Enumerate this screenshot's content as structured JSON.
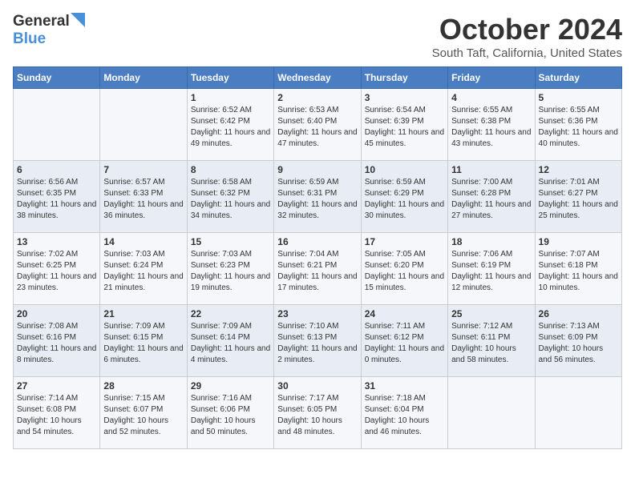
{
  "header": {
    "logo_general": "General",
    "logo_blue": "Blue",
    "month": "October 2024",
    "location": "South Taft, California, United States"
  },
  "weekdays": [
    "Sunday",
    "Monday",
    "Tuesday",
    "Wednesday",
    "Thursday",
    "Friday",
    "Saturday"
  ],
  "weeks": [
    [
      {
        "day": "",
        "info": ""
      },
      {
        "day": "",
        "info": ""
      },
      {
        "day": "1",
        "info": "Sunrise: 6:52 AM\nSunset: 6:42 PM\nDaylight: 11 hours and 49 minutes."
      },
      {
        "day": "2",
        "info": "Sunrise: 6:53 AM\nSunset: 6:40 PM\nDaylight: 11 hours and 47 minutes."
      },
      {
        "day": "3",
        "info": "Sunrise: 6:54 AM\nSunset: 6:39 PM\nDaylight: 11 hours and 45 minutes."
      },
      {
        "day": "4",
        "info": "Sunrise: 6:55 AM\nSunset: 6:38 PM\nDaylight: 11 hours and 43 minutes."
      },
      {
        "day": "5",
        "info": "Sunrise: 6:55 AM\nSunset: 6:36 PM\nDaylight: 11 hours and 40 minutes."
      }
    ],
    [
      {
        "day": "6",
        "info": "Sunrise: 6:56 AM\nSunset: 6:35 PM\nDaylight: 11 hours and 38 minutes."
      },
      {
        "day": "7",
        "info": "Sunrise: 6:57 AM\nSunset: 6:33 PM\nDaylight: 11 hours and 36 minutes."
      },
      {
        "day": "8",
        "info": "Sunrise: 6:58 AM\nSunset: 6:32 PM\nDaylight: 11 hours and 34 minutes."
      },
      {
        "day": "9",
        "info": "Sunrise: 6:59 AM\nSunset: 6:31 PM\nDaylight: 11 hours and 32 minutes."
      },
      {
        "day": "10",
        "info": "Sunrise: 6:59 AM\nSunset: 6:29 PM\nDaylight: 11 hours and 30 minutes."
      },
      {
        "day": "11",
        "info": "Sunrise: 7:00 AM\nSunset: 6:28 PM\nDaylight: 11 hours and 27 minutes."
      },
      {
        "day": "12",
        "info": "Sunrise: 7:01 AM\nSunset: 6:27 PM\nDaylight: 11 hours and 25 minutes."
      }
    ],
    [
      {
        "day": "13",
        "info": "Sunrise: 7:02 AM\nSunset: 6:25 PM\nDaylight: 11 hours and 23 minutes."
      },
      {
        "day": "14",
        "info": "Sunrise: 7:03 AM\nSunset: 6:24 PM\nDaylight: 11 hours and 21 minutes."
      },
      {
        "day": "15",
        "info": "Sunrise: 7:03 AM\nSunset: 6:23 PM\nDaylight: 11 hours and 19 minutes."
      },
      {
        "day": "16",
        "info": "Sunrise: 7:04 AM\nSunset: 6:21 PM\nDaylight: 11 hours and 17 minutes."
      },
      {
        "day": "17",
        "info": "Sunrise: 7:05 AM\nSunset: 6:20 PM\nDaylight: 11 hours and 15 minutes."
      },
      {
        "day": "18",
        "info": "Sunrise: 7:06 AM\nSunset: 6:19 PM\nDaylight: 11 hours and 12 minutes."
      },
      {
        "day": "19",
        "info": "Sunrise: 7:07 AM\nSunset: 6:18 PM\nDaylight: 11 hours and 10 minutes."
      }
    ],
    [
      {
        "day": "20",
        "info": "Sunrise: 7:08 AM\nSunset: 6:16 PM\nDaylight: 11 hours and 8 minutes."
      },
      {
        "day": "21",
        "info": "Sunrise: 7:09 AM\nSunset: 6:15 PM\nDaylight: 11 hours and 6 minutes."
      },
      {
        "day": "22",
        "info": "Sunrise: 7:09 AM\nSunset: 6:14 PM\nDaylight: 11 hours and 4 minutes."
      },
      {
        "day": "23",
        "info": "Sunrise: 7:10 AM\nSunset: 6:13 PM\nDaylight: 11 hours and 2 minutes."
      },
      {
        "day": "24",
        "info": "Sunrise: 7:11 AM\nSunset: 6:12 PM\nDaylight: 11 hours and 0 minutes."
      },
      {
        "day": "25",
        "info": "Sunrise: 7:12 AM\nSunset: 6:11 PM\nDaylight: 10 hours and 58 minutes."
      },
      {
        "day": "26",
        "info": "Sunrise: 7:13 AM\nSunset: 6:09 PM\nDaylight: 10 hours and 56 minutes."
      }
    ],
    [
      {
        "day": "27",
        "info": "Sunrise: 7:14 AM\nSunset: 6:08 PM\nDaylight: 10 hours and 54 minutes."
      },
      {
        "day": "28",
        "info": "Sunrise: 7:15 AM\nSunset: 6:07 PM\nDaylight: 10 hours and 52 minutes."
      },
      {
        "day": "29",
        "info": "Sunrise: 7:16 AM\nSunset: 6:06 PM\nDaylight: 10 hours and 50 minutes."
      },
      {
        "day": "30",
        "info": "Sunrise: 7:17 AM\nSunset: 6:05 PM\nDaylight: 10 hours and 48 minutes."
      },
      {
        "day": "31",
        "info": "Sunrise: 7:18 AM\nSunset: 6:04 PM\nDaylight: 10 hours and 46 minutes."
      },
      {
        "day": "",
        "info": ""
      },
      {
        "day": "",
        "info": ""
      }
    ]
  ]
}
